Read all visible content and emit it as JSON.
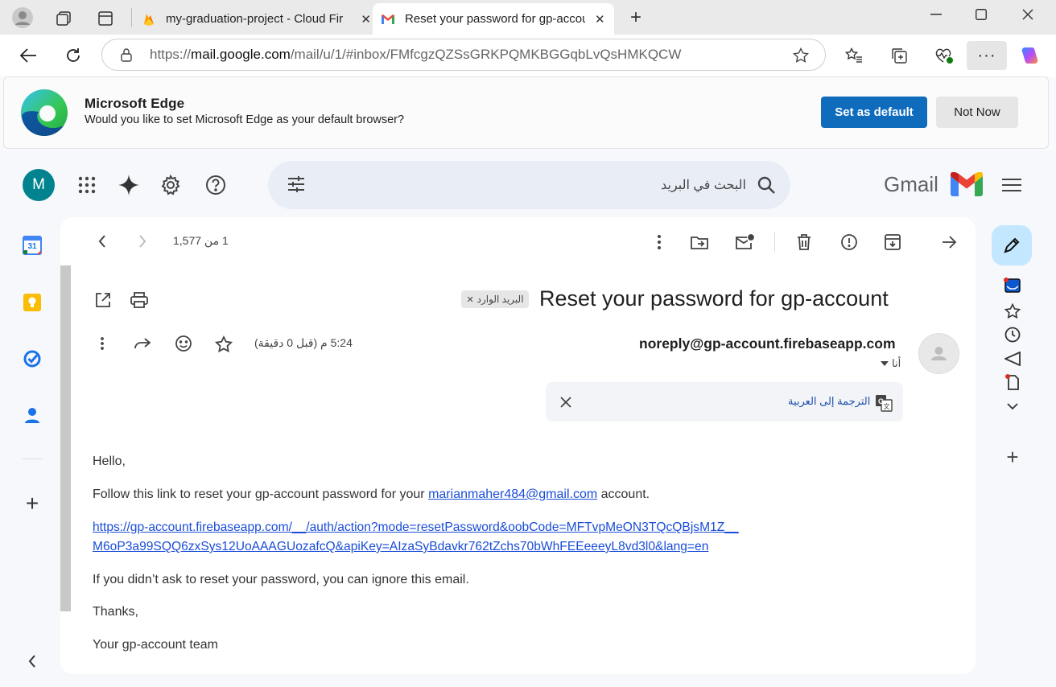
{
  "browser": {
    "tabs": [
      {
        "title": "my-graduation-project - Cloud Fir"
      },
      {
        "title": "Reset your password for gp-accou"
      }
    ],
    "url_prefix": "https://",
    "url_host": "mail.google.com",
    "url_path": "/mail/u/1/#inbox/FMfcgzQZSsGRKPQMKBGGqbLvQsHMKQCW"
  },
  "banner": {
    "title": "Microsoft Edge",
    "message": "Would you like to set Microsoft Edge as your default browser?",
    "primary_label": "Set as default",
    "secondary_label": "Not Now"
  },
  "gmail": {
    "avatar_letter": "M",
    "search_placeholder": "البحث في البريد",
    "brand": "Gmail",
    "pager": "1 من 1,577",
    "subject": "Reset your password for gp-account",
    "label_chip": "البريد الوارد",
    "sender": "noreply@gp-account.firebaseapp.com",
    "recipient": "أنا",
    "time": "5:24 م (قبل 0 دقيقة)",
    "translate_link": "الترجمة إلى العربية",
    "calendar_day": "31",
    "body": {
      "greeting": "Hello,",
      "line1_pre": "Follow this link to reset your gp-account password for your ",
      "line1_email": "marianmaher484@gmail.com",
      "line1_post": " account.",
      "reset_link_line1": "https://gp-account.firebaseapp.com/__/auth/action?mode=resetPassword&oobCode=MFTvpMeON3TQcQBjsM1Z__",
      "reset_link_line2": "M6oP3a99SQQ6zxSys12UoAAAGUozafcQ&apiKey=AIzaSyBdavkr762tZchs70bWhFEEeeeyL8vd3l0&lang=en",
      "ignore_line": "If you didn’t ask to reset your password, you can ignore this email.",
      "thanks": "Thanks,",
      "signature": "Your gp-account team"
    }
  },
  "colors": {
    "edge_blue": "#0f6cbd",
    "gmail_bg": "#f6f8fc",
    "link_blue": "#1a4dd8",
    "avatar_teal": "#00838f"
  }
}
